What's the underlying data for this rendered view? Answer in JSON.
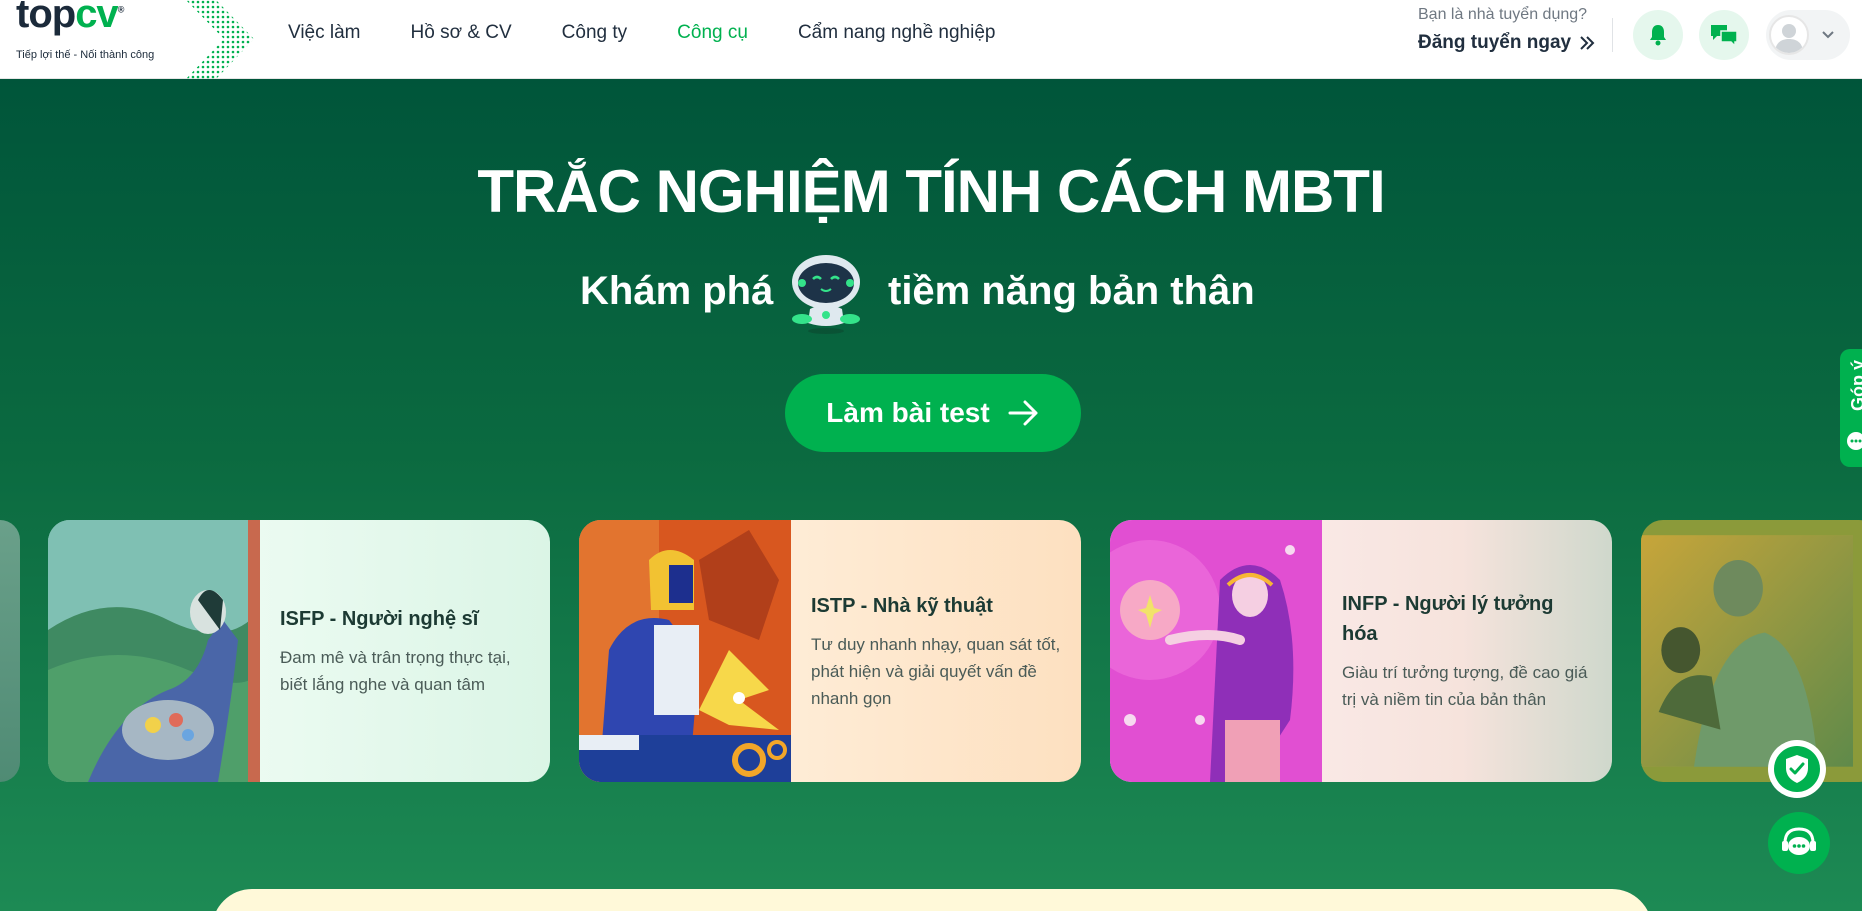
{
  "brand": {
    "name_top": "top",
    "name_cv": "cv",
    "tagline": "Tiếp lợi thế - Nối thành công"
  },
  "nav": {
    "items": [
      {
        "label": "Việc làm",
        "active": false
      },
      {
        "label": "Hồ sơ & CV",
        "active": false
      },
      {
        "label": "Công ty",
        "active": false
      },
      {
        "label": "Công cụ",
        "active": true
      },
      {
        "label": "Cẩm nang nghề nghiệp",
        "active": false
      }
    ]
  },
  "recruiter": {
    "question": "Bạn là nhà tuyển dụng?",
    "link": "Đăng tuyển ngay",
    "link_icon": "double-chevron-right-icon"
  },
  "header_icons": {
    "notification": "bell-icon",
    "messages": "chat-icon",
    "account": "user-avatar",
    "account_menu": "chevron-down-icon"
  },
  "hero": {
    "title": "TRẮC NGHIỆM TÍNH CÁCH MBTI",
    "subtitle_before": "Khám phá",
    "subtitle_after": "tiềm năng bản thân",
    "mascot": "robot-mascot",
    "cta_label": "Làm bài test",
    "cta_icon": "arrow-right-icon"
  },
  "cards": [
    {
      "title": "ISFP - Người nghệ sĩ",
      "description": "Đam mê và trân trọng thực tại, biết lắng nghe và quan tâm",
      "illustration": "painter-illustration"
    },
    {
      "title": "ISTP - Nhà kỹ thuật",
      "description": "Tư duy nhanh nhạy, quan sát tốt, phát hiện và giải quyết vấn đề nhanh gọn",
      "illustration": "welder-illustration"
    },
    {
      "title": "INFP - Người lý tưởng hóa",
      "description": "Giàu trí tưởng tượng, đề cao giá trị và niềm tin của bản thân",
      "illustration": "idealist-illustration"
    }
  ],
  "side_widgets": {
    "feedback_label": "Góp ý",
    "security_icon": "shield-check-icon",
    "support_icon": "support-chat-icon"
  },
  "colors": {
    "brand_green": "#00b14f",
    "hero_top": "#00553a",
    "hero_bottom": "#1d8a54",
    "text_dark": "#212f3f"
  }
}
